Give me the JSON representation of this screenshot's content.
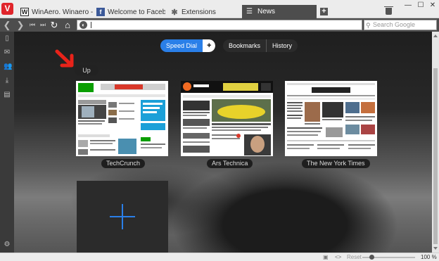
{
  "tabs": [
    {
      "label": "WinAero. Winaero - Free",
      "favicon": "W"
    },
    {
      "label": "Welcome to Facebook - L",
      "favicon": "f"
    },
    {
      "label": "Extensions",
      "favicon": "puzzle"
    },
    {
      "label": "News",
      "favicon": "news",
      "active": true
    }
  ],
  "toolbar": {
    "search_placeholder": "Search Google",
    "url_value": ""
  },
  "speed_dial": {
    "tab_speed_dial": "Speed Dial",
    "add_button": "+",
    "tab_bookmarks": "Bookmarks",
    "tab_history": "History",
    "up_label": "Up",
    "tiles": [
      {
        "name": "TechCrunch"
      },
      {
        "name": "Ars Technica"
      },
      {
        "name": "The New York Times"
      }
    ]
  },
  "statusbar": {
    "reset_label": "Reset",
    "zoom_label": "100 %",
    "zoom_level": 100
  },
  "colors": {
    "accent": "#2a7fe8",
    "brand_red": "#e0252b",
    "arrow_red": "#e8231a"
  },
  "icons": {
    "sidebar": [
      "bookmark-icon",
      "mail-icon",
      "contacts-icon",
      "download-icon",
      "notes-icon",
      "settings-icon"
    ]
  }
}
